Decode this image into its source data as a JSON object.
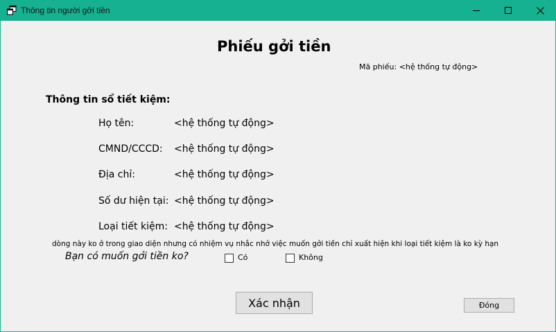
{
  "window": {
    "title": "Thông tin người gởi tiền",
    "controls": [
      "minimize-icon",
      "maximize-icon",
      "close-icon"
    ]
  },
  "form": {
    "heading": "Phiếu gởi tiền",
    "receipt_code_label": "Mã phiếu:",
    "receipt_code_value": "<hệ thống tự động>",
    "section_title": "Thông tin sổ tiết kiệm:",
    "fields": [
      {
        "label": "Họ tên:",
        "value": "<hệ thống tự động>"
      },
      {
        "label": "CMND/CCCD:",
        "value": "<hệ thống tự động>"
      },
      {
        "label": "Địa chỉ:",
        "value": "<hệ thống tự động>"
      },
      {
        "label": "Số dư hiện tại:",
        "value": "<hệ thống tự động>"
      },
      {
        "label": "Loại tiết kiệm:",
        "value": "<hệ thống tự động>"
      }
    ],
    "note": "dòng này ko ở trong giao diện nhưng có nhiệm vụ nhắc nhở việc muốn gởi tiền chỉ xuất hiện khi loại tiết kiệm là ko  kỳ hạn",
    "question": "Bạn có muốn gởi tiền ko?",
    "option_yes": "Có",
    "option_no": "Không",
    "confirm_button": "Xác nhận",
    "close_button": "Đóng"
  }
}
